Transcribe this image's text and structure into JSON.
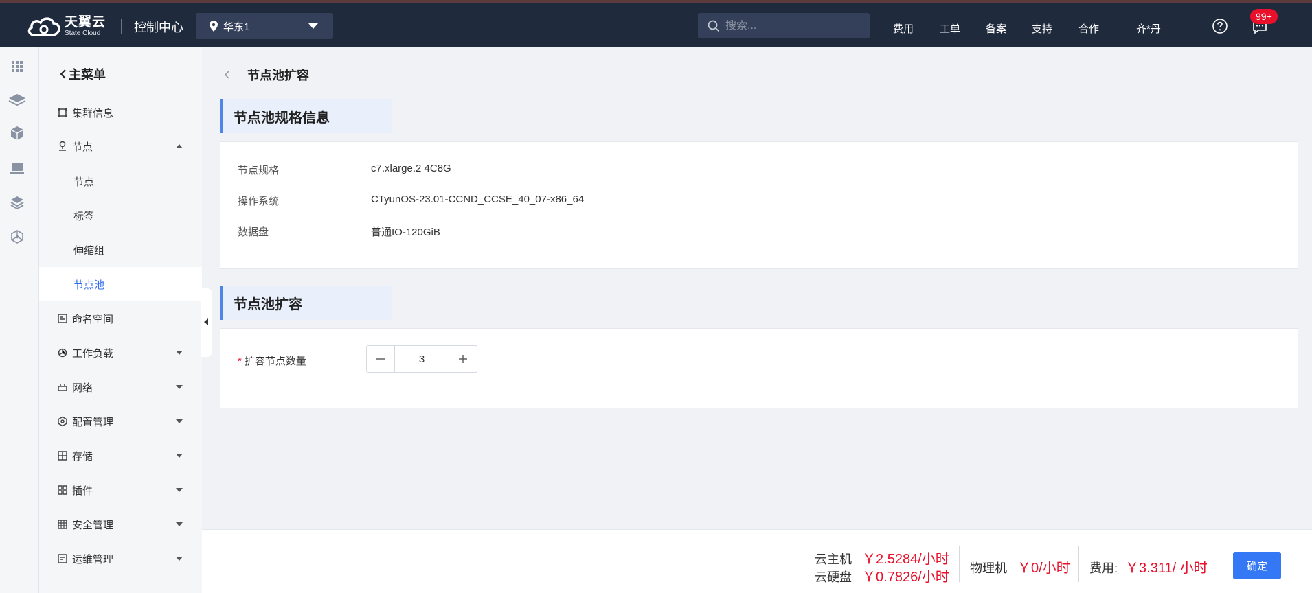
{
  "topbar": {
    "brand_cn": "天翼云",
    "brand_en": "State Cloud",
    "console_title": "控制中心",
    "region": "华东1",
    "search_placeholder": "搜索...",
    "nav": [
      "费用",
      "工单",
      "备案",
      "支持",
      "合作"
    ],
    "user": "齐*丹",
    "badge": "99+"
  },
  "rail": {
    "icons": [
      "grid-icon",
      "layers-icon",
      "cube-icon",
      "monitor-icon",
      "stack-icon",
      "network-cube-icon"
    ]
  },
  "sidebar": {
    "back_label": "主菜单",
    "items": [
      {
        "label": "集群信息",
        "icon": "cluster-icon"
      },
      {
        "label": "节点",
        "icon": "node-pin-icon",
        "expanded": true
      },
      {
        "label": "节点"
      },
      {
        "label": "标签"
      },
      {
        "label": "伸缩组"
      },
      {
        "label": "节点池",
        "active": true
      },
      {
        "label": "命名空间",
        "icon": "namespace-icon"
      },
      {
        "label": "工作负载",
        "icon": "workload-icon"
      },
      {
        "label": "网络",
        "icon": "router-icon"
      },
      {
        "label": "配置管理",
        "icon": "config-icon"
      },
      {
        "label": "存储",
        "icon": "storage-icon"
      },
      {
        "label": "插件",
        "icon": "plugin-icon"
      },
      {
        "label": "安全管理",
        "icon": "security-icon"
      },
      {
        "label": "运维管理",
        "icon": "ops-icon"
      }
    ]
  },
  "main": {
    "page_title": "节点池扩容",
    "spec_section_title": "节点池规格信息",
    "spec": [
      {
        "key": "节点规格",
        "value": "c7.xlarge.2 4C8G"
      },
      {
        "key": "操作系统",
        "value": "CTyunOS-23.01-CCND_CCSE_40_07-x86_64"
      },
      {
        "key": "数据盘",
        "value": "普通IO-120GiB"
      }
    ],
    "scale_section_title": "节点池扩容",
    "scale_field_label": "扩容节点数量",
    "scale_required_mark": "*",
    "scale_value": "3"
  },
  "footer": {
    "ecs_label": "云主机",
    "ecs_price": "￥2.5284/小时",
    "disk_label": "云硬盘",
    "disk_price": "￥0.7826/小时",
    "physical_label": "物理机",
    "physical_price": "￥0/小时",
    "fee_label": "费用:",
    "fee_price": "￥3.311/ 小时",
    "confirm_label": "确定"
  },
  "colors": {
    "topbar_bg": "#1f2a3d",
    "accent": "#3478f6",
    "price_red": "#e8102a"
  }
}
